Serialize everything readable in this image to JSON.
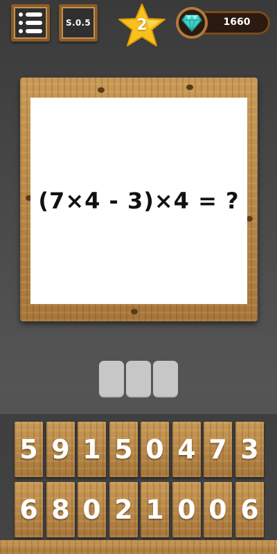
{
  "topbar": {
    "sos_label": "S.0.5",
    "level": "2",
    "gems": "1660"
  },
  "puzzle": {
    "question": "(7×4 - 3)×4 = ?"
  },
  "answer": {
    "slots": [
      "",
      "",
      ""
    ]
  },
  "keypad": {
    "row1": [
      "5",
      "9",
      "1",
      "5",
      "0",
      "4",
      "7",
      "3"
    ],
    "row2": [
      "6",
      "8",
      "0",
      "2",
      "1",
      "0",
      "0",
      "6"
    ]
  },
  "colors": {
    "star": "#f7c21b",
    "gem": "#3fd1c8",
    "wood": "#c99a56"
  }
}
